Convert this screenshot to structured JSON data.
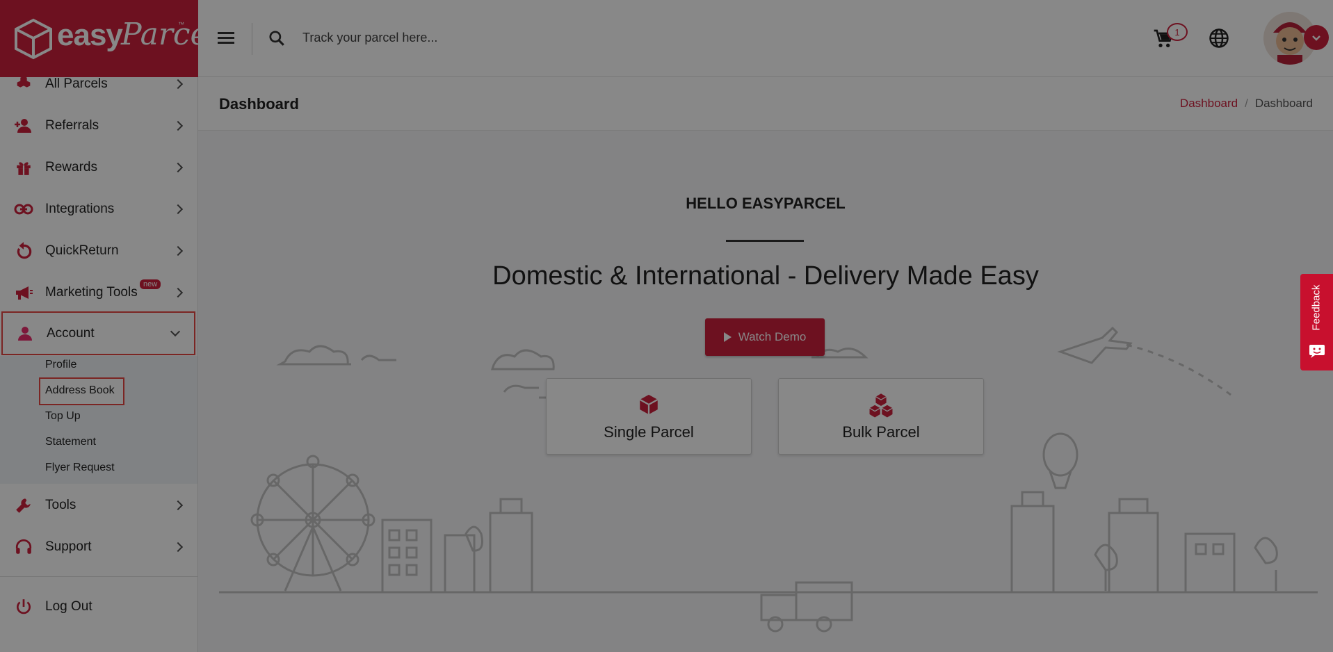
{
  "brand": {
    "name_part1": "easy",
    "name_part2": "Parcel",
    "tm": "™"
  },
  "sidebar": {
    "items": [
      {
        "label": "All Parcels",
        "icon": "boxes-icon"
      },
      {
        "label": "Referrals",
        "icon": "add-user-icon"
      },
      {
        "label": "Rewards",
        "icon": "gift-icon"
      },
      {
        "label": "Integrations",
        "icon": "link-icon"
      },
      {
        "label": "QuickReturn",
        "icon": "return-icon"
      },
      {
        "label": "Marketing Tools",
        "icon": "megaphone-icon",
        "badge": "new"
      },
      {
        "label": "Account",
        "icon": "person-icon",
        "expanded": true
      },
      {
        "label": "Tools",
        "icon": "wrench-icon"
      },
      {
        "label": "Support",
        "icon": "headset-icon"
      }
    ],
    "account_submenu": [
      "Profile",
      "Address Book",
      "Top Up",
      "Statement",
      "Flyer Request"
    ],
    "logout": "Log Out"
  },
  "header": {
    "search_placeholder": "Track your parcel here...",
    "cart_count": "1"
  },
  "page": {
    "title": "Dashboard",
    "breadcrumb": [
      "Dashboard",
      "Dashboard"
    ]
  },
  "main": {
    "hello": "HELLO EASYPARCEL",
    "tagline": "Domestic & International - Delivery Made Easy",
    "demo_button": "Watch Demo",
    "cards": [
      "Single Parcel",
      "Bulk Parcel"
    ]
  },
  "feedback": "Feedback",
  "colors": {
    "brand": "#c8102e",
    "overlay": "rgba(17,17,17,0.5)",
    "highlight": "#e53935"
  }
}
